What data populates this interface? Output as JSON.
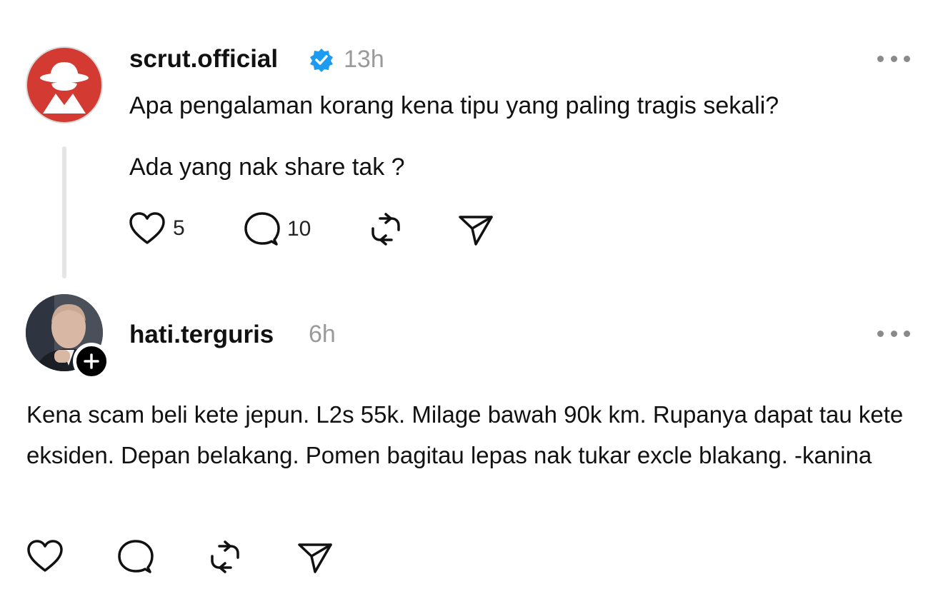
{
  "post1": {
    "username": "scrut.official",
    "verified_icon": "verified-badge-icon",
    "time": "13h",
    "text_line1": "Apa pengalaman korang kena tipu yang paling tragis sekali?",
    "text_line2": "Ada yang nak share tak ?",
    "likes": "5",
    "replies": "10"
  },
  "post2": {
    "username": "hati.terguris",
    "time": "6h",
    "text": "Kena scam beli kete jepun.  L2s 55k. Milage bawah 90k km. Rupanya dapat tau kete eksiden. Depan belakang. Pomen bagitau lepas nak tukar excle blakang. -kanina"
  },
  "colors": {
    "avatar_red": "#d23a32",
    "verified_blue": "#1d9bf0",
    "muted_text": "#9a9a9a",
    "thread_line": "#e5e5e5"
  }
}
